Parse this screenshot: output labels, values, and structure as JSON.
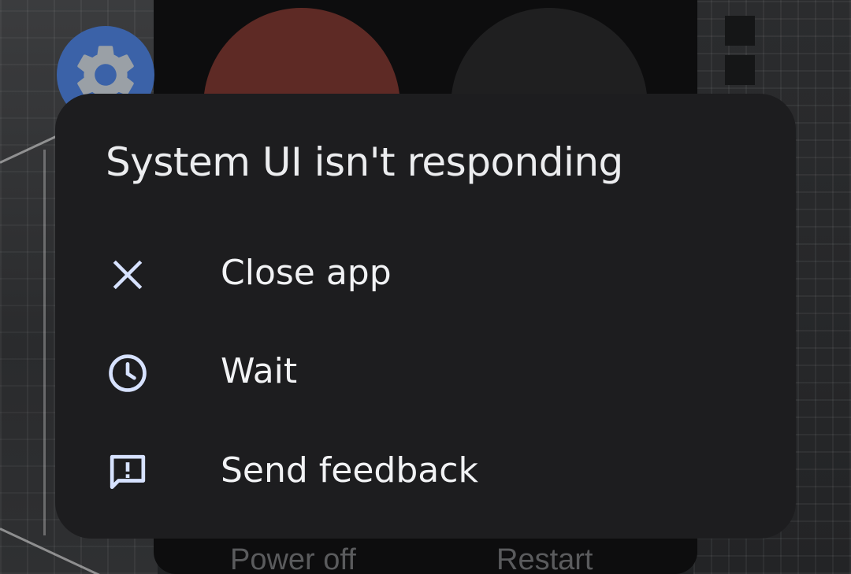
{
  "dialog": {
    "title": "System UI isn't responding",
    "options": [
      {
        "label": "Close app",
        "icon": "close-icon"
      },
      {
        "label": "Wait",
        "icon": "clock-icon"
      },
      {
        "label": "Send feedback",
        "icon": "feedback-icon"
      }
    ]
  },
  "power_menu": {
    "power_off_label": "Power off",
    "restart_label": "Restart"
  },
  "settings_shortcut": {
    "icon": "gear-icon"
  },
  "colors": {
    "dialog_background": "#1d1d1f",
    "icon_tint": "#d7e2ff",
    "text": "#f1f2f4",
    "gear_bubble": "#3b62a8",
    "power_off_button": "#5e2a25"
  }
}
